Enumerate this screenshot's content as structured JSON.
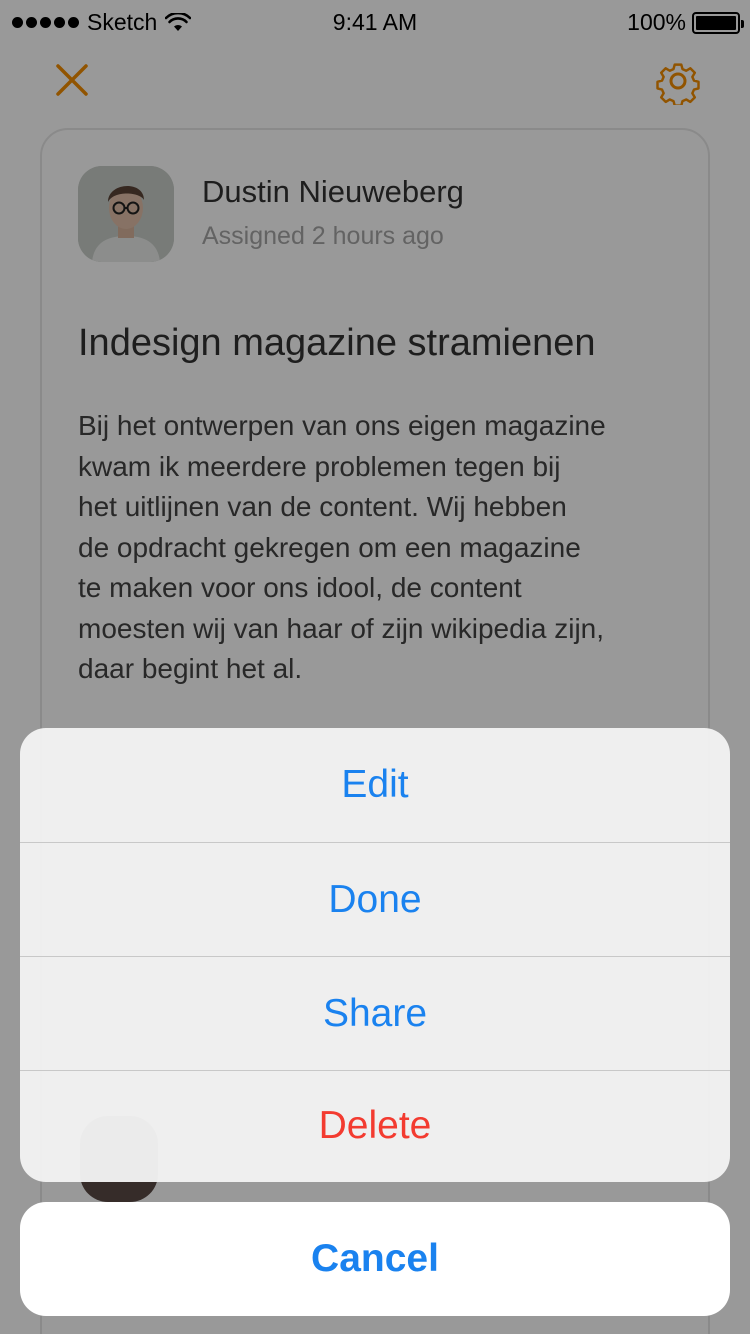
{
  "status_bar": {
    "carrier": "Sketch",
    "time": "9:41 AM",
    "battery": "100%"
  },
  "nav": {
    "close_icon": "close-icon",
    "settings_icon": "gear-icon",
    "accent_color": "#f28c00"
  },
  "card": {
    "user": {
      "name": "Dustin Nieuweberg",
      "meta": "Assigned 2 hours ago"
    },
    "title": "Indesign magazine stramienen",
    "description_lines": [
      "Bij het ontwerpen van ons eigen magazine",
      "kwam ik meerdere problemen tegen bij",
      "het uitlijnen van de content. Wij hebben",
      "de opdracht gekregen om een magazine",
      "te maken voor ons idool, de content",
      "moesten wij van haar of zijn wikipedia zijn,",
      "daar begint het al."
    ]
  },
  "action_sheet": {
    "items": [
      {
        "label": "Edit"
      },
      {
        "label": "Done"
      },
      {
        "label": "Share"
      },
      {
        "label": "Delete"
      }
    ],
    "cancel_label": "Cancel",
    "action_color": "#1a82ef",
    "destructive_color": "#f33b30"
  }
}
